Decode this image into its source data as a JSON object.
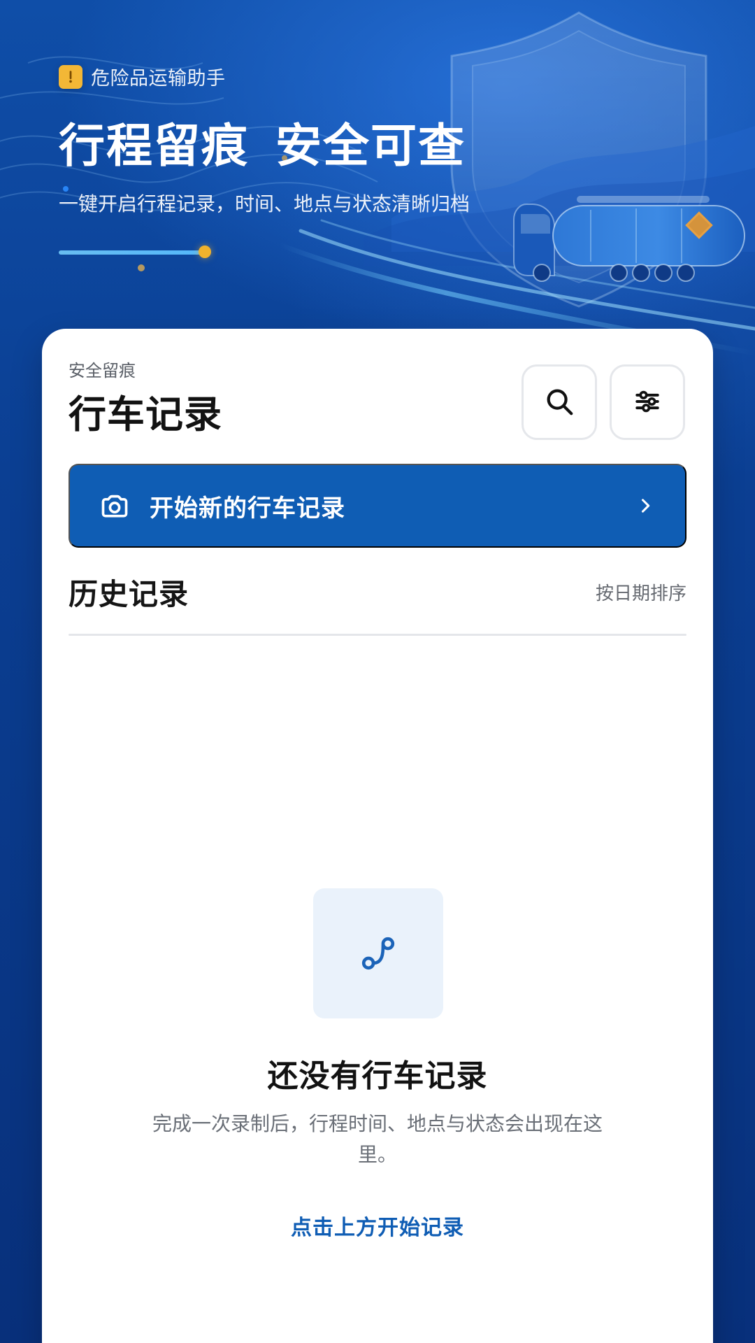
{
  "hero": {
    "badge_icon": "warning-icon",
    "badge_text": "危险品运输助手",
    "title_left": "行程留痕",
    "title_right": "安全可查",
    "subtitle": "一键开启行程记录，时间、地点与状态清晰归档",
    "accent_color": "#f0b22d"
  },
  "card": {
    "kicker": "安全留痕",
    "title": "行车记录",
    "search_icon": "search-icon",
    "filter_icon": "sliders-icon",
    "primary_action": {
      "icon": "camera-icon",
      "label": "开始新的行车记录",
      "chevron_icon": "chevron-right-icon",
      "bg_color": "#0f5db4"
    },
    "history": {
      "title": "历史记录",
      "sort_label": "按日期排序"
    },
    "empty_state": {
      "icon": "route-icon",
      "title": "还没有行车记录",
      "description": "完成一次录制后，行程时间、地点与状态会出现在这里。",
      "cta": "点击上方开始记录"
    }
  }
}
